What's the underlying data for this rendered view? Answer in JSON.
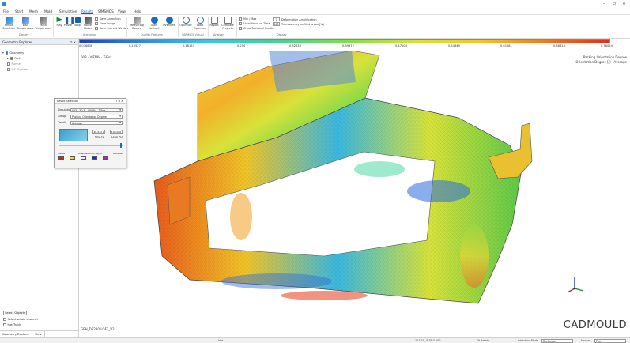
{
  "menu": [
    "File",
    "Start",
    "Mesh",
    "Mold",
    "Simulation",
    "Results",
    "SIMSMOS",
    "View",
    "Help"
  ],
  "menu_active_index": 5,
  "ribbon": {
    "result_selection": "Result Selection",
    "wall_temperature": "Wall Temperature",
    "metal_temperature": "Metal Temperature",
    "play": "Play",
    "pause": "Pause",
    "stop": "Stop",
    "movie_maker": "Movie Maker",
    "save_animation": "Save Animation",
    "save_image": "Save Image",
    "save_current_window": "Save Current Window",
    "measuring_device": "Measuring Device",
    "user_defined": "User-defined",
    "overview": "Overview",
    "optimize": "Optimize",
    "load_optimum": "Load Optimum",
    "report": "Report",
    "compare_projects": "Compare Projects",
    "min_max": "Min / Max",
    "local_value_vs_time": "Local Value vs Time",
    "cross_sectional_profiles": "Cross Sectional Profiles",
    "deformation_amplification": "Deformation Amplification",
    "transparency": "Transparency unfilled areas [%]",
    "deformation_value": "1",
    "transparency_value": "100",
    "groups": [
      "Display",
      "Animation",
      "Quality Features",
      "VARIMOS Virtual",
      "Analysis",
      "Display"
    ]
  },
  "colorbar": {
    "ticks": [
      "0.036808",
      "0.10527",
      "0.18163",
      "0.254",
      "0.32636",
      "0.39872",
      "0.47108",
      "0.54345",
      "0.61581",
      "0.68818",
      "0.76054"
    ],
    "colors": {
      "low": "#1e3fc4",
      "mid": "#7ce04a",
      "high": "#e52b17"
    }
  },
  "sidebar": {
    "title": "Geometry Explorer",
    "pin": "⊓ ✕",
    "tree": [
      {
        "label": "Geometry",
        "checked": true,
        "dim": false
      },
      {
        "label": "Parts",
        "checked": true,
        "dim": false
      },
      {
        "label": "Runner",
        "checked": false,
        "dim": true
      },
      {
        "label": "H/C System",
        "checked": false,
        "dim": true
      }
    ],
    "select_objects": "Select Objects",
    "select_whole_channel": "Select whole channel",
    "hot_track": "Hot Track",
    "tabs": [
      "Geometry Explorer",
      "View"
    ]
  },
  "viewport": {
    "top_left_label": "003 - VIFNIV - T-Box",
    "top_right_line1": "Packing Orientation Degree",
    "top_right_line2": "Orientation Degree [/] - Average",
    "bottom_left_label": "GEH_D5230-LOF3_V2",
    "watermark": "CADMOULD"
  },
  "dialog": {
    "title": "Result Selection",
    "controls": "? ⊓ ✕",
    "simulation_label": "Simulation",
    "simulation_value": "003 - 3D-P - VIFNIV - T-Box",
    "group_label": "Group",
    "group_value": "Packing Orientation Degree",
    "detail_label": "Detail",
    "detail_value": "Average",
    "time_value": "46.412 s",
    "level_value": "100.000",
    "time_label": "Time [s]",
    "level_label": "Level [%]",
    "inside_label": "Inside",
    "outside_label": "Outside",
    "orientation_label": "Orientation in Layer",
    "swatch_colors": [
      "#e02020",
      "#f0e020",
      "#f4f4f4",
      "#1830c8",
      "#c020c0"
    ]
  },
  "statusbar": {
    "mode": "Idle",
    "coords": "107.40, 0.78 0.000",
    "fit_rotate": "Fit Rotate",
    "selection_mode_label": "Selection Mode",
    "selection_mode_value": "Rectangle",
    "mouse_label": "Mouse",
    "mouse_value": "Pan"
  }
}
